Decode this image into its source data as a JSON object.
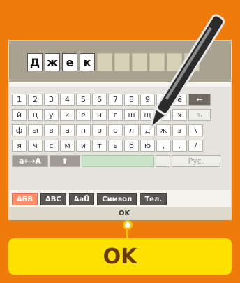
{
  "name_input": {
    "letters": [
      "Д",
      "ж",
      "е",
      "к"
    ],
    "empty_cells": 6
  },
  "keyboard": {
    "row1": [
      "1",
      "2",
      "3",
      "4",
      "5",
      "6",
      "7",
      "8",
      "9",
      "0",
      "ё",
      "←"
    ],
    "row2": [
      "й",
      "ц",
      "у",
      "к",
      "е",
      "н",
      "г",
      "ш",
      "щ",
      "з",
      "х",
      "ъ"
    ],
    "row3": [
      "ф",
      "ы",
      "в",
      "а",
      "п",
      "р",
      "о",
      "л",
      "д",
      "ж",
      "э",
      "\\"
    ],
    "row4": [
      "я",
      "ч",
      "с",
      "м",
      "и",
      "т",
      "ь",
      "б",
      "ю",
      ",",
      ".",
      "/"
    ],
    "switch_label": "а⟷А",
    "shift_label": "⬆",
    "space_label": "",
    "lang_label": "Рус."
  },
  "tabs": [
    "АБВ",
    "ABC",
    "AaÜ",
    "Символ",
    "Тел."
  ],
  "ok": {
    "label_small": "OK",
    "label": "OK"
  },
  "colors": {
    "background": "#ee7b0a",
    "ok_bar": "#ffe100",
    "active_tab": "#ff8f6a"
  }
}
